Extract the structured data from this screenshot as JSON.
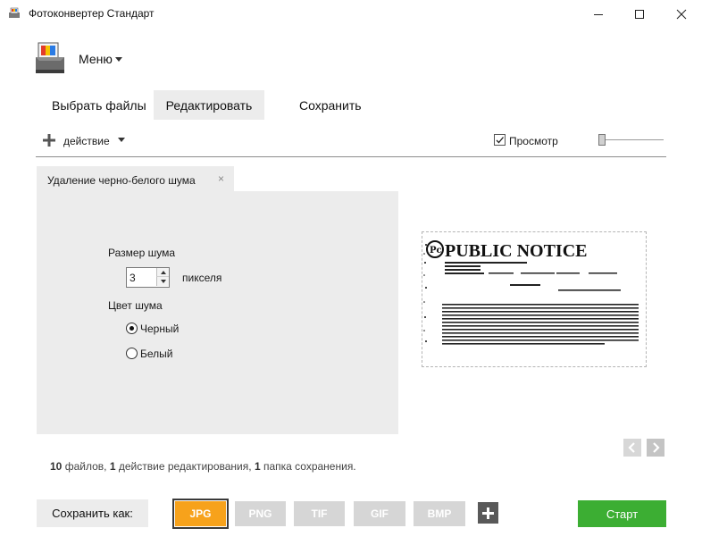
{
  "window": {
    "title": "Фотоконвертер Стандарт",
    "app_icon": "photo-converter-icon",
    "controls": [
      "minimize-icon",
      "maximize-icon",
      "close-icon"
    ]
  },
  "menu": {
    "label": "Меню"
  },
  "tabs": [
    {
      "label": "Выбрать файлы",
      "active": false
    },
    {
      "label": "Редактировать",
      "active": true
    },
    {
      "label": "Сохранить",
      "active": false
    }
  ],
  "toolbar": {
    "action_label": "действие",
    "preview_label": "Просмотр",
    "preview_checked": true
  },
  "effect": {
    "tab_title": "Удаление черно-белого шума",
    "close_glyph": "×",
    "noise_size_label": "Размер шума",
    "noise_size_value": "3",
    "pixels_label": "пикселя",
    "color_label": "Цвет шума",
    "options": [
      {
        "label": "Черный",
        "selected": true
      },
      {
        "label": "Белый",
        "selected": false
      }
    ]
  },
  "preview_image": {
    "headline": "PUBLIC NOTICE"
  },
  "stats": {
    "files_count": "10",
    "files_label": "файлов,",
    "actions_count": "1",
    "actions_label": "действие редактирования,",
    "folders_count": "1",
    "folders_label": "папка сохранения."
  },
  "bottom": {
    "save_as_label": "Сохранить как:",
    "formats": [
      "JPG",
      "PNG",
      "TIF",
      "GIF",
      "BMP"
    ],
    "selected_format": "JPG",
    "start_label": "Старт"
  },
  "colors": {
    "accent_orange": "#f7a21b",
    "start_green": "#3cae33",
    "panel_gray": "#ececec",
    "format_gray": "#d6d6d6"
  }
}
